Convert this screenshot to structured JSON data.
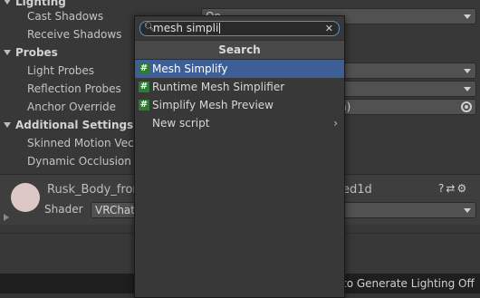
{
  "inspector": {
    "lighting": {
      "header": "Lighting",
      "cast_shadows_label": "Cast Shadows",
      "cast_shadows_value": "On",
      "receive_shadows_label": "Receive Shadows"
    },
    "probes": {
      "header": "Probes",
      "light_probes_label": "Light Probes",
      "reflection_probes_label": "Reflection Probes",
      "anchor_override_label": "Anchor Override",
      "anchor_override_value": "n)"
    },
    "additional": {
      "header": "Additional Settings",
      "skinned_motion_label": "Skinned Motion Vect",
      "dynamic_occlusion_label": "Dynamic Occlusion"
    }
  },
  "material": {
    "name": "Rusk_Body_fron",
    "name_suffix": "ed1d",
    "shader_label": "Shader",
    "shader_value": "VRChat",
    "help_icon": "?",
    "settings_icon": "⚙"
  },
  "status_bar": {
    "text": "to Generate Lighting Off"
  },
  "popup": {
    "search_value": "mesh simpli",
    "title": "Search",
    "items": [
      {
        "label": "Mesh Simplify",
        "icon": "#",
        "selected": true
      },
      {
        "label": "Runtime Mesh Simplifier",
        "icon": "#"
      },
      {
        "label": "Simplify Mesh Preview",
        "icon": "#"
      },
      {
        "label": "New script",
        "chevron": "›"
      }
    ]
  }
}
